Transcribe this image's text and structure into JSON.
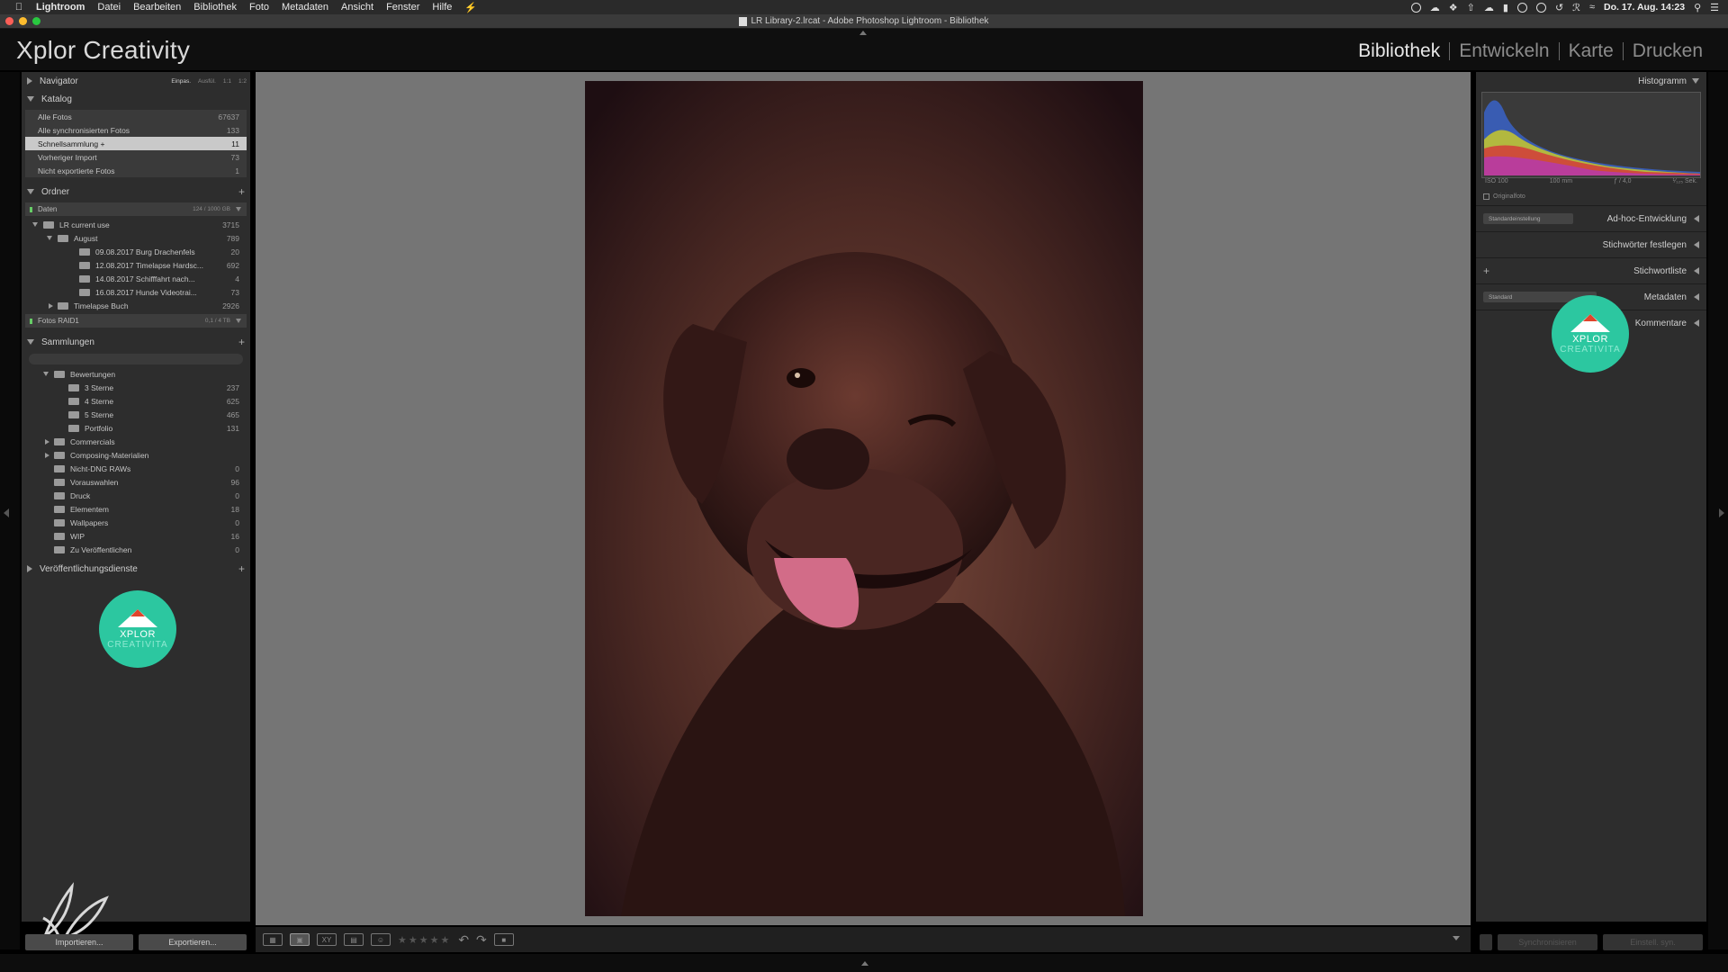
{
  "menubar": {
    "app": "Lightroom",
    "items": [
      "Datei",
      "Bearbeiten",
      "Bibliothek",
      "Foto",
      "Metadaten",
      "Ansicht",
      "Fenster",
      "Hilfe"
    ],
    "datetime": "Do. 17. Aug.  14:23"
  },
  "window": {
    "title": "LR Library-2.lrcat - Adobe Photoshop Lightroom - Bibliothek"
  },
  "identity_plate": "Xplor Creativity",
  "modules": [
    {
      "label": "Bibliothek",
      "active": true
    },
    {
      "label": "Entwickeln",
      "active": false
    },
    {
      "label": "Karte",
      "active": false
    },
    {
      "label": "Drucken",
      "active": false
    }
  ],
  "left": {
    "navigator": {
      "title": "Navigator",
      "modes": [
        "Einpas.",
        "Ausfül.",
        "1:1",
        "1:2"
      ]
    },
    "catalog": {
      "title": "Katalog",
      "items": [
        {
          "label": "Alle Fotos",
          "count": "67637"
        },
        {
          "label": "Alle synchronisierten Fotos",
          "count": "133"
        },
        {
          "label": "Schnellsammlung +",
          "count": "11",
          "selected": true
        },
        {
          "label": "Vorheriger Import",
          "count": "73"
        },
        {
          "label": "Nicht exportierte Fotos",
          "count": "1"
        }
      ]
    },
    "folders": {
      "title": "Ordner",
      "volume1": {
        "name": "Daten",
        "info": "124 / 1000 GB"
      },
      "tree": [
        {
          "label": "LR current use",
          "count": "3715",
          "level": 1,
          "tri": "down"
        },
        {
          "label": "August",
          "count": "789",
          "level": 2,
          "tri": "down"
        },
        {
          "label": "09.08.2017 Burg Drachenfels",
          "count": "20",
          "level": 3
        },
        {
          "label": "12.08.2017 Timelapse Hardsc...",
          "count": "692",
          "level": 3
        },
        {
          "label": "14.08.2017 Schifffahrt nach...",
          "count": "4",
          "level": 3
        },
        {
          "label": "16.08.2017 Hunde Videotrai...",
          "count": "73",
          "level": 3
        },
        {
          "label": "Timelapse Buch",
          "count": "2926",
          "level": 2,
          "tri": "right"
        }
      ],
      "volume2": {
        "name": "Fotos RAID1",
        "info": "0,1 / 4 TB"
      }
    },
    "collections": {
      "title": "Sammlungen",
      "tree": [
        {
          "label": "Bewertungen",
          "count": "",
          "level": 1,
          "tri": "down"
        },
        {
          "label": "3 Sterne",
          "count": "237",
          "level": 2
        },
        {
          "label": "4 Sterne",
          "count": "625",
          "level": 2
        },
        {
          "label": "5 Sterne",
          "count": "465",
          "level": 2
        },
        {
          "label": "Portfolio",
          "count": "131",
          "level": 2
        },
        {
          "label": "Commercials",
          "count": "",
          "level": 1,
          "tri": "right"
        },
        {
          "label": "Composing-Materialien",
          "count": "",
          "level": 1,
          "tri": "right"
        },
        {
          "label": "Nicht-DNG RAWs",
          "count": "0",
          "level": 1
        },
        {
          "label": "Vorauswahlen",
          "count": "96",
          "level": 1
        },
        {
          "label": "Druck",
          "count": "0",
          "level": 1
        },
        {
          "label": "Elementem",
          "count": "18",
          "level": 1
        },
        {
          "label": "Wallpapers",
          "count": "0",
          "level": 1
        },
        {
          "label": "WIP",
          "count": "16",
          "level": 1
        },
        {
          "label": "Zu Veröffentlichen",
          "count": "0",
          "level": 1
        }
      ]
    },
    "publish": {
      "title": "Veröffentlichungsdienste"
    },
    "buttons": {
      "import": "Importieren...",
      "export": "Exportieren..."
    }
  },
  "badge": {
    "line1": "XPLOR",
    "line2": "CREATIVITA"
  },
  "right": {
    "histogram": {
      "title": "Histogramm",
      "iso": "ISO 100",
      "focal": "100 mm",
      "aperture": "ƒ / 4,0",
      "shutter": "¹⁄₁₂₅ Sek.",
      "original": "Originalfoto"
    },
    "quick_develop": {
      "title": "Ad-hoc-Entwicklung",
      "preset": "Standardeinstellung"
    },
    "keywording": {
      "title": "Stichwörter festlegen"
    },
    "keyword_list": {
      "title": "Stichwortliste"
    },
    "metadata": {
      "title": "Metadaten",
      "preset": "Standard"
    },
    "comments": {
      "title": "Kommentare"
    },
    "buttons": {
      "sync": "Synchronisieren",
      "sync_settings": "Einstell. syn."
    }
  },
  "colors": {
    "accent_badge": "#2cc7a0",
    "panel_bg": "#2d2d2d",
    "center_bg": "#757575"
  }
}
